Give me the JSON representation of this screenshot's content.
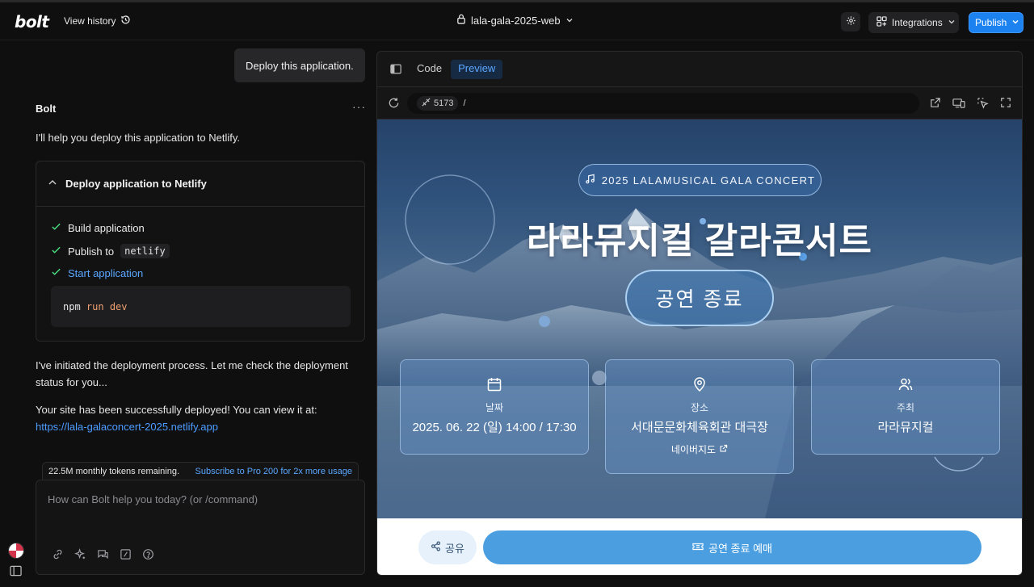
{
  "topbar": {
    "logo": "bolt",
    "view_history": "View history",
    "project_name": "lala-gala-2025-web",
    "integrations": "Integrations",
    "publish": "Publish"
  },
  "chat": {
    "user_message": "Deploy this application.",
    "assistant_name": "Bolt",
    "more": "···",
    "intro": "I'll help you deploy this application to Netlify.",
    "action_card": {
      "title": "Deploy application to Netlify",
      "steps": [
        {
          "label": "Build application"
        },
        {
          "label": "Publish to",
          "chip": "netlify"
        },
        {
          "label": "Start application"
        }
      ],
      "command": {
        "cmd": "npm",
        "args": "run dev"
      }
    },
    "msg_initiated": "I've initiated the deployment process. Let me check the deployment status for you...",
    "msg_success": "Your site has been successfully deployed! You can view it at:",
    "deploy_url": "https://lala-galaconcert-2025.netlify.app",
    "tokens_remaining": "22.5M monthly tokens remaining.",
    "subscribe": "Subscribe to Pro 200 for 2x more usage",
    "input_placeholder": "How can Bolt help you today? (or /command)"
  },
  "preview": {
    "tabs": [
      "Code",
      "Preview"
    ],
    "active_tab": "Preview",
    "port": "5173",
    "path": "/",
    "site": {
      "badge": "2025 LALAMUSICAL GALA CONCERT",
      "title": "라라뮤지컬 갈라콘서트",
      "status": "공연 종료",
      "cards": {
        "date": {
          "label": "날짜",
          "value": "2025. 06. 22 (일) 14:00 / 17:30"
        },
        "place": {
          "label": "장소",
          "value": "서대문문화체육회관 대극장",
          "link": "네이버지도"
        },
        "host": {
          "label": "주최",
          "value": "라라뮤지컬"
        }
      },
      "share": "공유",
      "book": "공연 종료 예매"
    }
  },
  "colors": {
    "accent": "#1c82f0",
    "link": "#5aa7ff",
    "check": "#4ade80",
    "hero_blue": "#2f527c",
    "book_button": "#4b9fe0"
  },
  "icons": [
    "history-icon",
    "lock-icon",
    "chevron-down-icon",
    "gear-icon",
    "integrations-icon",
    "check-icon",
    "chevron-up-icon",
    "link-icon",
    "sparkle-icon",
    "chat-icon",
    "slash-command-icon",
    "help-icon",
    "panel-toggle-icon",
    "reload-icon",
    "port-icon",
    "external-link-icon",
    "devices-icon",
    "inspect-icon",
    "fullscreen-icon",
    "music-note-icon",
    "calendar-icon",
    "map-pin-icon",
    "users-icon",
    "share-icon",
    "ticket-icon"
  ]
}
